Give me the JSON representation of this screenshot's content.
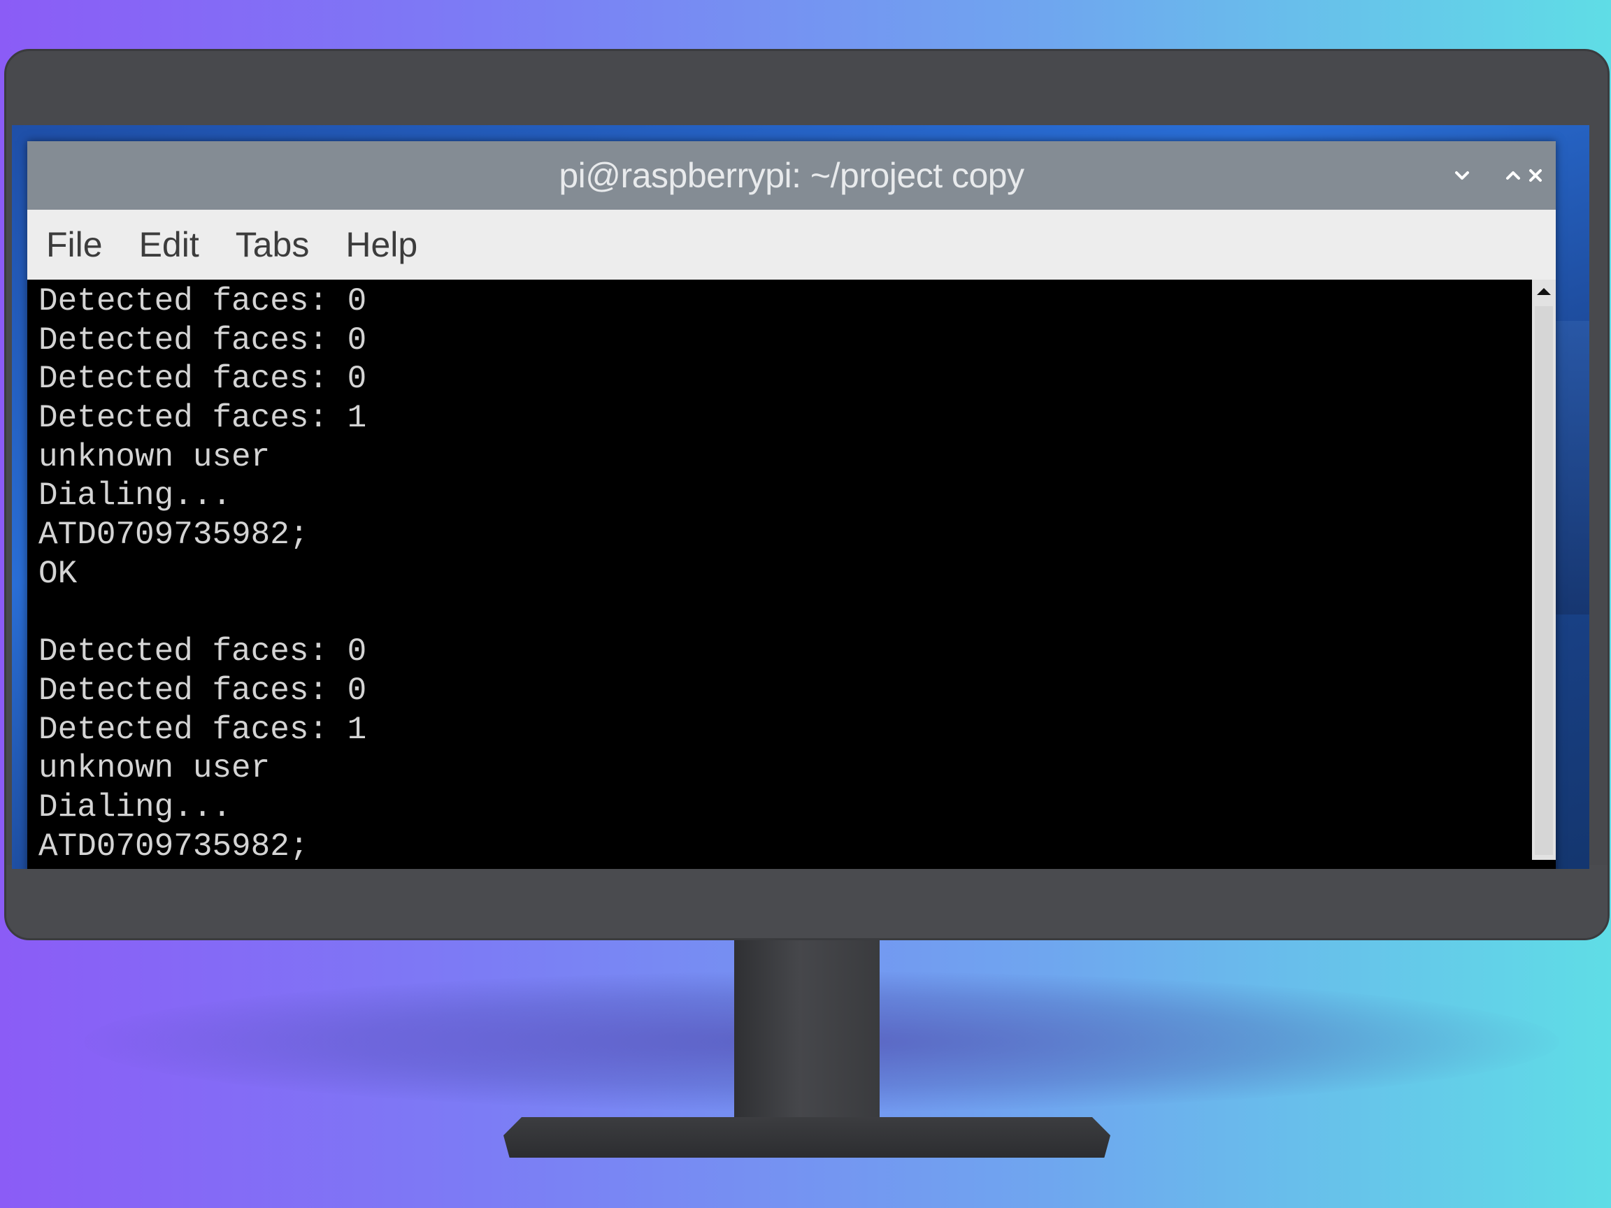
{
  "window": {
    "title": "pi@raspberrypi: ~/project copy"
  },
  "window_controls": {
    "minimize_icon": "chevron-down-icon",
    "maximize_icon": "chevron-up-icon",
    "close_icon": "close-icon"
  },
  "menubar": {
    "items": [
      {
        "label": "File"
      },
      {
        "label": "Edit"
      },
      {
        "label": "Tabs"
      },
      {
        "label": "Help"
      }
    ]
  },
  "terminal": {
    "lines": [
      "Detected faces: 0",
      "Detected faces: 0",
      "Detected faces: 0",
      "Detected faces: 1",
      "unknown user",
      "Dialing...",
      "ATD0709735982;",
      "OK",
      "",
      "Detected faces: 0",
      "Detected faces: 0",
      "Detected faces: 1",
      "unknown user",
      "Dialing...",
      "ATD0709735982;"
    ]
  },
  "scrollbar": {
    "up_icon": "triangle-up-icon"
  },
  "colors": {
    "titlebar": "#848c94",
    "menubar": "#ededed",
    "terminal_bg": "#000000",
    "terminal_fg": "#d4d4d4"
  }
}
